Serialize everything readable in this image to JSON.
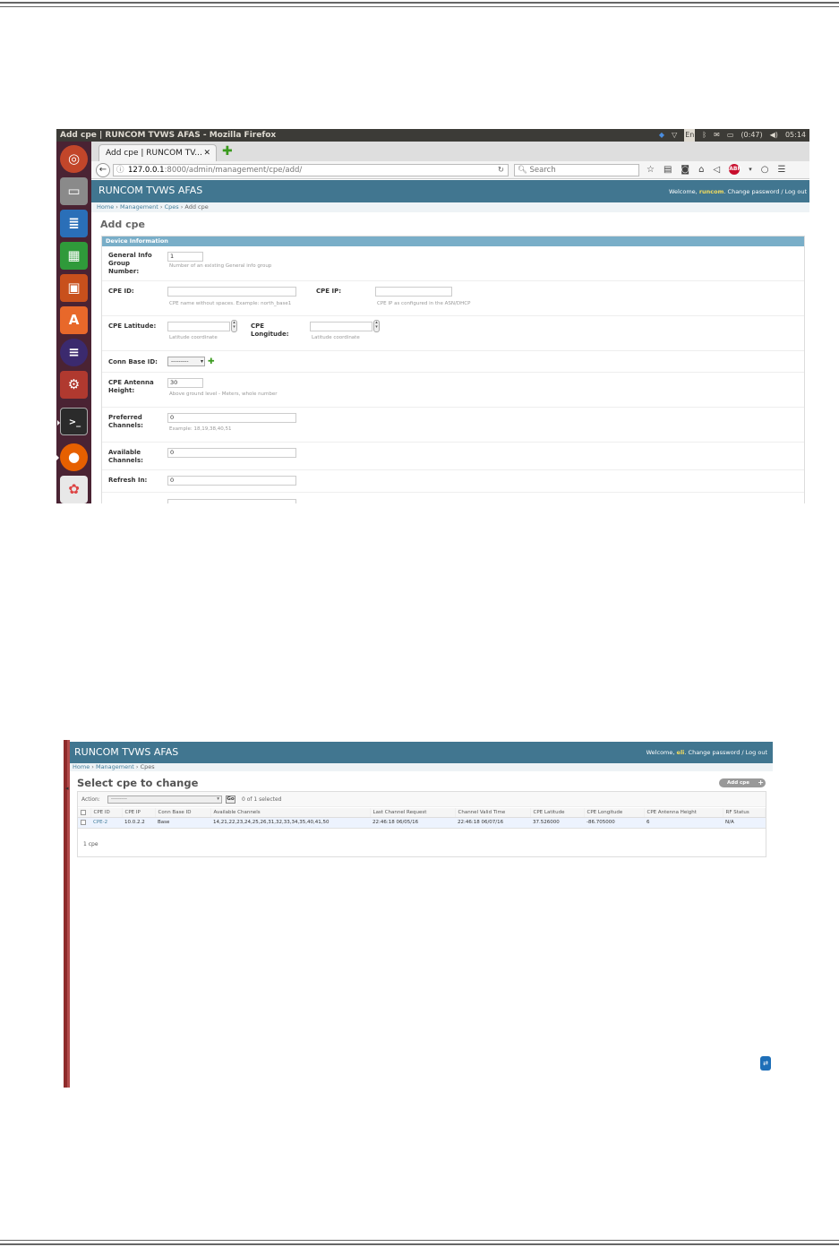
{
  "shot1": {
    "os_title": "Add cpe | RUNCOM TVWS AFAS - Mozilla Firefox",
    "tray": {
      "keyboard": "En",
      "battery": "(0:47)",
      "clock": "05:14"
    },
    "launcher": [
      "ubuntu-dash",
      "files",
      "writer",
      "calc",
      "impress",
      "software-center",
      "eclipse",
      "system-settings",
      "terminal",
      "firefox",
      "app-icon"
    ],
    "tab_label": "Add cpe | RUNCOM TV...",
    "url_host": "127.0.0.1",
    "url_rest": ":8000/admin/management/cpe/add/",
    "search_placeholder": "Search",
    "site_name": "RUNCOM TVWS AFAS",
    "welcome": "Welcome,",
    "user": "runcom",
    "tools_rest": ". Change password / Log out",
    "crumbs": {
      "home": "Home",
      "app": "Management",
      "model": "Cpes",
      "current": "Add cpe",
      "sep": "›"
    },
    "page_title": "Add cpe",
    "fieldset_title": "Device Information",
    "fields": {
      "group_label": "General Info Group Number:",
      "group_value": "1",
      "group_help": "Number of an existing General info group",
      "cpe_id_label": "CPE ID:",
      "cpe_id_help": "CPE name without spaces. Example: north_base1",
      "cpe_ip_label": "CPE IP:",
      "cpe_ip_help": "CPE IP as configured in the ASN/DHCP",
      "lat_label": "CPE Latitude:",
      "lat_help": "Latitude coordinate",
      "lon_label": "CPE Longitude:",
      "lon_help": "Latitude coordinate",
      "conn_label": "Conn Base ID:",
      "conn_value": "---------",
      "height_label": "CPE Antenna Height:",
      "height_value": "30",
      "height_help": "Above ground level - Meters, whole number",
      "pref_label": "Preferred Channels:",
      "pref_value": "0",
      "pref_help": "Example: 18,19,38,40,51",
      "avail_label": "Available Channels:",
      "avail_value": "0",
      "refresh_label": "Refresh In:",
      "refresh_value": "0"
    }
  },
  "shot2": {
    "site_name": "RUNCOM TVWS AFAS",
    "welcome": "Welcome,",
    "user": "eli",
    "tools_rest": ". Change password / Log out",
    "crumbs": {
      "home": "Home",
      "app": "Management",
      "model": "Cpes",
      "sep": "›"
    },
    "page_title": "Select cpe to change",
    "add_button": "Add cpe",
    "action_label": "Action:",
    "action_value": "---------",
    "go_label": "Go",
    "selected_count": "0 of 1 selected",
    "columns": [
      "CPE ID",
      "CPE IP",
      "Conn Base ID",
      "Available Channels",
      "Last Channel Request",
      "Channel Valid Time",
      "CPE Latitude",
      "CPE Longitude",
      "CPE Antenna Height",
      "RF Status"
    ],
    "row": {
      "cpe_id": "CPE-2",
      "cpe_ip": "10.0.2.2",
      "conn_base": "Base",
      "channels": "14,21,22,23,24,25,26,31,32,33,34,35,40,41,50",
      "last_request": "22:46:18 06/05/16",
      "valid_time": "22:46:18 06/07/16",
      "latitude": "37.526000",
      "longitude": "-86.705000",
      "height": "6",
      "rf_status": "N/A"
    },
    "count_text": "1 cpe"
  }
}
